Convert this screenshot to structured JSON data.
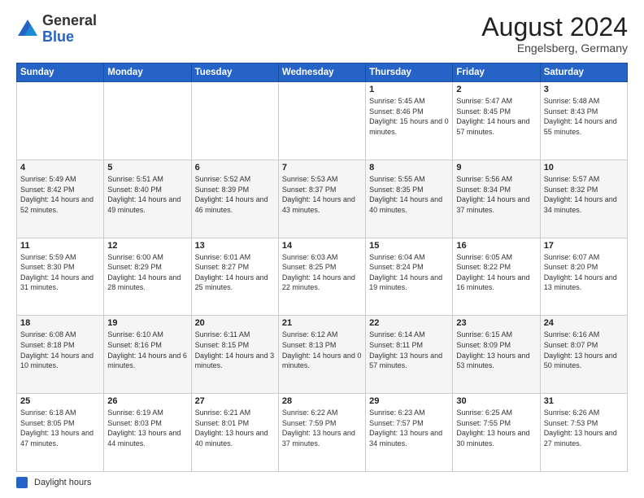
{
  "header": {
    "logo_general": "General",
    "logo_blue": "Blue",
    "month_year": "August 2024",
    "location": "Engelsberg, Germany"
  },
  "calendar": {
    "weekdays": [
      "Sunday",
      "Monday",
      "Tuesday",
      "Wednesday",
      "Thursday",
      "Friday",
      "Saturday"
    ],
    "weeks": [
      [
        {
          "day": "",
          "info": ""
        },
        {
          "day": "",
          "info": ""
        },
        {
          "day": "",
          "info": ""
        },
        {
          "day": "",
          "info": ""
        },
        {
          "day": "1",
          "info": "Sunrise: 5:45 AM\nSunset: 8:46 PM\nDaylight: 15 hours\nand 0 minutes."
        },
        {
          "day": "2",
          "info": "Sunrise: 5:47 AM\nSunset: 8:45 PM\nDaylight: 14 hours\nand 57 minutes."
        },
        {
          "day": "3",
          "info": "Sunrise: 5:48 AM\nSunset: 8:43 PM\nDaylight: 14 hours\nand 55 minutes."
        }
      ],
      [
        {
          "day": "4",
          "info": "Sunrise: 5:49 AM\nSunset: 8:42 PM\nDaylight: 14 hours\nand 52 minutes."
        },
        {
          "day": "5",
          "info": "Sunrise: 5:51 AM\nSunset: 8:40 PM\nDaylight: 14 hours\nand 49 minutes."
        },
        {
          "day": "6",
          "info": "Sunrise: 5:52 AM\nSunset: 8:39 PM\nDaylight: 14 hours\nand 46 minutes."
        },
        {
          "day": "7",
          "info": "Sunrise: 5:53 AM\nSunset: 8:37 PM\nDaylight: 14 hours\nand 43 minutes."
        },
        {
          "day": "8",
          "info": "Sunrise: 5:55 AM\nSunset: 8:35 PM\nDaylight: 14 hours\nand 40 minutes."
        },
        {
          "day": "9",
          "info": "Sunrise: 5:56 AM\nSunset: 8:34 PM\nDaylight: 14 hours\nand 37 minutes."
        },
        {
          "day": "10",
          "info": "Sunrise: 5:57 AM\nSunset: 8:32 PM\nDaylight: 14 hours\nand 34 minutes."
        }
      ],
      [
        {
          "day": "11",
          "info": "Sunrise: 5:59 AM\nSunset: 8:30 PM\nDaylight: 14 hours\nand 31 minutes."
        },
        {
          "day": "12",
          "info": "Sunrise: 6:00 AM\nSunset: 8:29 PM\nDaylight: 14 hours\nand 28 minutes."
        },
        {
          "day": "13",
          "info": "Sunrise: 6:01 AM\nSunset: 8:27 PM\nDaylight: 14 hours\nand 25 minutes."
        },
        {
          "day": "14",
          "info": "Sunrise: 6:03 AM\nSunset: 8:25 PM\nDaylight: 14 hours\nand 22 minutes."
        },
        {
          "day": "15",
          "info": "Sunrise: 6:04 AM\nSunset: 8:24 PM\nDaylight: 14 hours\nand 19 minutes."
        },
        {
          "day": "16",
          "info": "Sunrise: 6:05 AM\nSunset: 8:22 PM\nDaylight: 14 hours\nand 16 minutes."
        },
        {
          "day": "17",
          "info": "Sunrise: 6:07 AM\nSunset: 8:20 PM\nDaylight: 14 hours\nand 13 minutes."
        }
      ],
      [
        {
          "day": "18",
          "info": "Sunrise: 6:08 AM\nSunset: 8:18 PM\nDaylight: 14 hours\nand 10 minutes."
        },
        {
          "day": "19",
          "info": "Sunrise: 6:10 AM\nSunset: 8:16 PM\nDaylight: 14 hours\nand 6 minutes."
        },
        {
          "day": "20",
          "info": "Sunrise: 6:11 AM\nSunset: 8:15 PM\nDaylight: 14 hours\nand 3 minutes."
        },
        {
          "day": "21",
          "info": "Sunrise: 6:12 AM\nSunset: 8:13 PM\nDaylight: 14 hours\nand 0 minutes."
        },
        {
          "day": "22",
          "info": "Sunrise: 6:14 AM\nSunset: 8:11 PM\nDaylight: 13 hours\nand 57 minutes."
        },
        {
          "day": "23",
          "info": "Sunrise: 6:15 AM\nSunset: 8:09 PM\nDaylight: 13 hours\nand 53 minutes."
        },
        {
          "day": "24",
          "info": "Sunrise: 6:16 AM\nSunset: 8:07 PM\nDaylight: 13 hours\nand 50 minutes."
        }
      ],
      [
        {
          "day": "25",
          "info": "Sunrise: 6:18 AM\nSunset: 8:05 PM\nDaylight: 13 hours\nand 47 minutes."
        },
        {
          "day": "26",
          "info": "Sunrise: 6:19 AM\nSunset: 8:03 PM\nDaylight: 13 hours\nand 44 minutes."
        },
        {
          "day": "27",
          "info": "Sunrise: 6:21 AM\nSunset: 8:01 PM\nDaylight: 13 hours\nand 40 minutes."
        },
        {
          "day": "28",
          "info": "Sunrise: 6:22 AM\nSunset: 7:59 PM\nDaylight: 13 hours\nand 37 minutes."
        },
        {
          "day": "29",
          "info": "Sunrise: 6:23 AM\nSunset: 7:57 PM\nDaylight: 13 hours\nand 34 minutes."
        },
        {
          "day": "30",
          "info": "Sunrise: 6:25 AM\nSunset: 7:55 PM\nDaylight: 13 hours\nand 30 minutes."
        },
        {
          "day": "31",
          "info": "Sunrise: 6:26 AM\nSunset: 7:53 PM\nDaylight: 13 hours\nand 27 minutes."
        }
      ]
    ]
  },
  "footer": {
    "legend_label": "Daylight hours"
  }
}
